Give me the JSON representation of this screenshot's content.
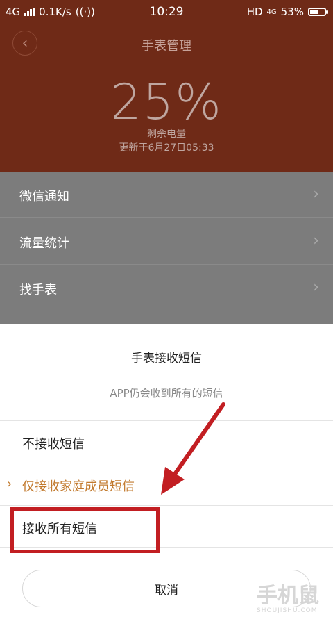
{
  "status": {
    "network": "4G",
    "speed": "0.1K/s",
    "time": "10:29",
    "hd": "HD",
    "volte": "4G",
    "battery": "53%"
  },
  "header": {
    "back_icon": "chevron-left-icon",
    "title": "手表管理",
    "battery_percent": "25%",
    "battery_label": "剩余电量",
    "updated": "更新于6月27日05:33",
    "color": "#6f2a17"
  },
  "menu": {
    "items": [
      {
        "label": "微信通知"
      },
      {
        "label": "流量统计"
      },
      {
        "label": "找手表"
      }
    ]
  },
  "sheet": {
    "title": "手表接收短信",
    "subtitle": "APP仍会收到所有的短信",
    "options": [
      {
        "label": "不接收短信",
        "selected": false
      },
      {
        "label": "仅接收家庭成员短信",
        "selected": true
      },
      {
        "label": "接收所有短信",
        "selected": false
      }
    ],
    "cancel": "取消",
    "accent_color": "#c27a2e"
  },
  "annotation": {
    "color": "#c21e22"
  },
  "watermark": {
    "text": "手机鼠",
    "sub": "SHOUJISHU.COM"
  }
}
